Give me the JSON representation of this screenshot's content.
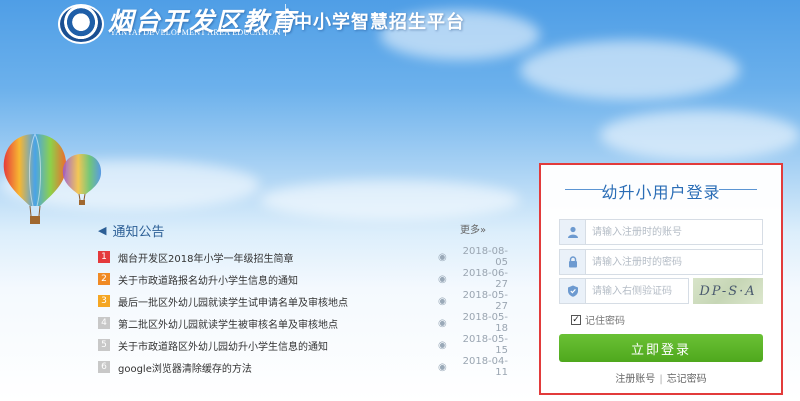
{
  "header": {
    "logo_cn": "烟台开发区教育",
    "logo_en": "YANTAI DEVELOPMENT AREA EDUCATION",
    "platform_title": "中小学智慧招生平台"
  },
  "notice": {
    "title": "通知公告",
    "more_label": "更多»",
    "items": [
      {
        "rank": "1",
        "text": "烟台开发区2018年小学一年级招生简章",
        "date": "2018-08-05",
        "color": "#e4393c"
      },
      {
        "rank": "2",
        "text": "关于市政道路报名幼升小学生信息的通知",
        "date": "2018-06-27",
        "color": "#f08a24"
      },
      {
        "rank": "3",
        "text": "最后一批区外幼儿园就读学生试申请名单及审核地点",
        "date": "2018-05-27",
        "color": "#f5a623"
      },
      {
        "rank": "4",
        "text": "第二批区外幼儿园就读学生被审核名单及审核地点",
        "date": "2018-05-18",
        "color": "#c8c8c8"
      },
      {
        "rank": "5",
        "text": "关于市政道路区外幼儿园幼升小学生信息的通知",
        "date": "2018-05-15",
        "color": "#c8c8c8"
      },
      {
        "rank": "6",
        "text": "google浏览器清除缓存的方法",
        "date": "2018-04-11",
        "color": "#c8c8c8"
      }
    ]
  },
  "login": {
    "title": "幼升小用户登录",
    "username_placeholder": "请输入注册时的账号",
    "password_placeholder": "请输入注册时的密码",
    "captcha_placeholder": "请输入右侧验证码",
    "captcha_text": "DP-S·A",
    "remember_label": "记住密码",
    "submit_label": "立即登录",
    "register_link": "注册账号",
    "forgot_link": "忘记密码"
  },
  "colors": {
    "login_border": "#e23b3b",
    "submit_green": "#55ad22",
    "title_blue": "#2a6db6"
  }
}
